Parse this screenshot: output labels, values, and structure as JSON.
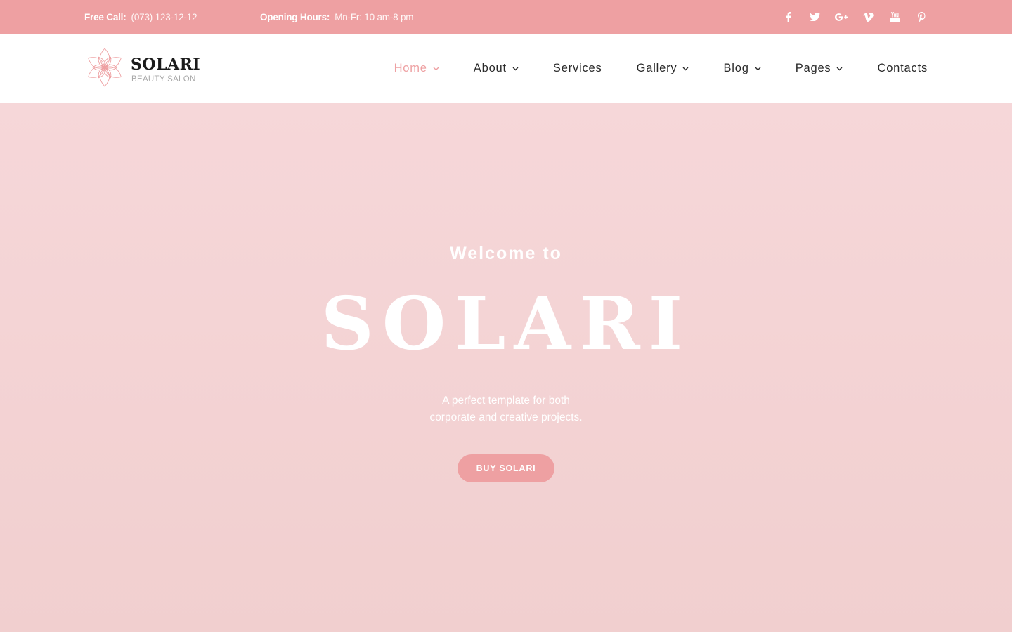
{
  "topbar": {
    "call_label": "Free Call:",
    "call_value": "(073) 123-12-12",
    "hours_label": "Opening Hours:",
    "hours_value": "Mn-Fr: 10 am-8 pm",
    "social": [
      "facebook-icon",
      "twitter-icon",
      "google-plus-icon",
      "vimeo-icon",
      "youtube-icon",
      "pinterest-icon"
    ]
  },
  "header": {
    "logo_title": "SOLARI",
    "logo_subtitle": "BEAUTY SALON",
    "nav": [
      {
        "label": "Home",
        "dropdown": true,
        "active": true
      },
      {
        "label": "About",
        "dropdown": true
      },
      {
        "label": "Services",
        "dropdown": false
      },
      {
        "label": "Gallery",
        "dropdown": true
      },
      {
        "label": "Blog",
        "dropdown": true
      },
      {
        "label": "Pages",
        "dropdown": true
      },
      {
        "label": "Contacts",
        "dropdown": false
      }
    ]
  },
  "hero": {
    "pretitle": "Welcome to",
    "title": "SOLARI",
    "desc_line1": "A perfect template for both",
    "desc_line2": "corporate and creative projects.",
    "button": "BUY SOLARI"
  },
  "colors": {
    "accent": "#eea0a2",
    "hero_bg": "#f4d3d4",
    "text_dark": "#2a2a2a"
  }
}
